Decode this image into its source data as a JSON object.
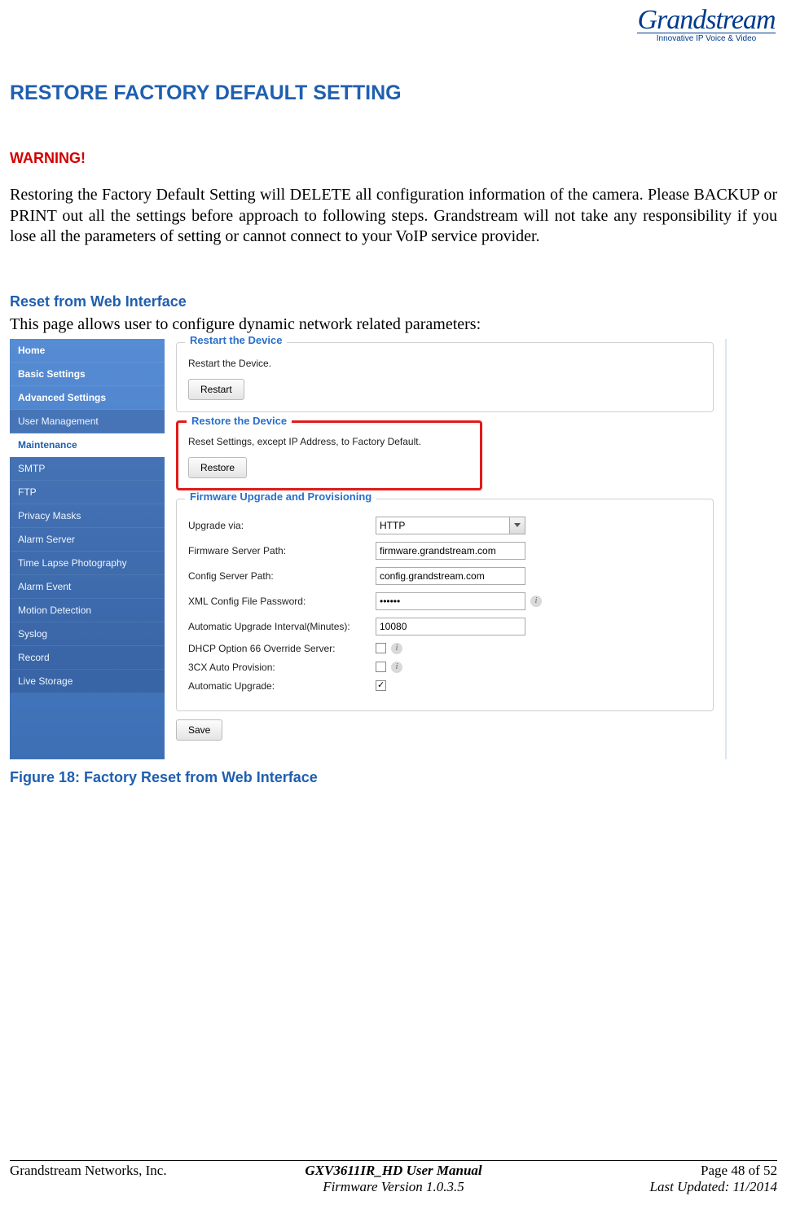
{
  "logo": {
    "brand": "Grandstream",
    "tagline": "Innovative IP Voice & Video"
  },
  "section_title": "RESTORE FACTORY DEFAULT SETTING",
  "warning_label": "WARNING!",
  "warning_body": "Restoring the Factory Default Setting will DELETE all configuration information of the camera. Please BACKUP or PRINT out all the settings before approach to following steps. Grandstream will not take any responsibility if you lose all the parameters of setting or cannot connect to your VoIP service provider.",
  "sub_heading": "Reset from Web Interface",
  "sub_intro": "This page allows user to configure dynamic network related parameters:",
  "sidebar": {
    "items": [
      {
        "label": "Home",
        "bold": true
      },
      {
        "label": "Basic Settings",
        "bold": true
      },
      {
        "label": "Advanced Settings",
        "bold": true
      },
      {
        "label": "User Management"
      },
      {
        "label": "Maintenance",
        "active": true
      },
      {
        "label": "SMTP"
      },
      {
        "label": "FTP"
      },
      {
        "label": "Privacy Masks"
      },
      {
        "label": "Alarm Server"
      },
      {
        "label": "Time Lapse Photography"
      },
      {
        "label": "Alarm Event"
      },
      {
        "label": "Motion Detection"
      },
      {
        "label": "Syslog"
      },
      {
        "label": "Record"
      },
      {
        "label": "Live Storage"
      }
    ]
  },
  "panel": {
    "restart": {
      "legend": "Restart the Device",
      "text": "Restart the Device.",
      "button": "Restart"
    },
    "restore": {
      "legend": "Restore the Device",
      "text": "Reset Settings, except IP Address, to Factory Default.",
      "button": "Restore"
    },
    "firmware": {
      "legend": "Firmware Upgrade and Provisioning",
      "upgrade_via_label": "Upgrade via:",
      "upgrade_via_value": "HTTP",
      "fw_path_label": "Firmware Server Path:",
      "fw_path_value": "firmware.grandstream.com",
      "cfg_path_label": "Config Server Path:",
      "cfg_path_value": "config.grandstream.com",
      "xml_pw_label": "XML Config File Password:",
      "xml_pw_value": "••••••",
      "interval_label": "Automatic Upgrade Interval(Minutes):",
      "interval_value": "10080",
      "dhcp66_label": "DHCP Option 66 Override Server:",
      "threecx_label": "3CX Auto Provision:",
      "auto_upgrade_label": "Automatic Upgrade:",
      "save_button": "Save"
    }
  },
  "figure_caption": "Figure 18:  Factory Reset from Web Interface",
  "footer": {
    "company": "Grandstream Networks, Inc.",
    "manual": "GXV3611IR_HD User Manual",
    "firmware": "Firmware Version 1.0.3.5",
    "page": "Page 48 of 52",
    "updated": "Last Updated: 11/2014"
  }
}
